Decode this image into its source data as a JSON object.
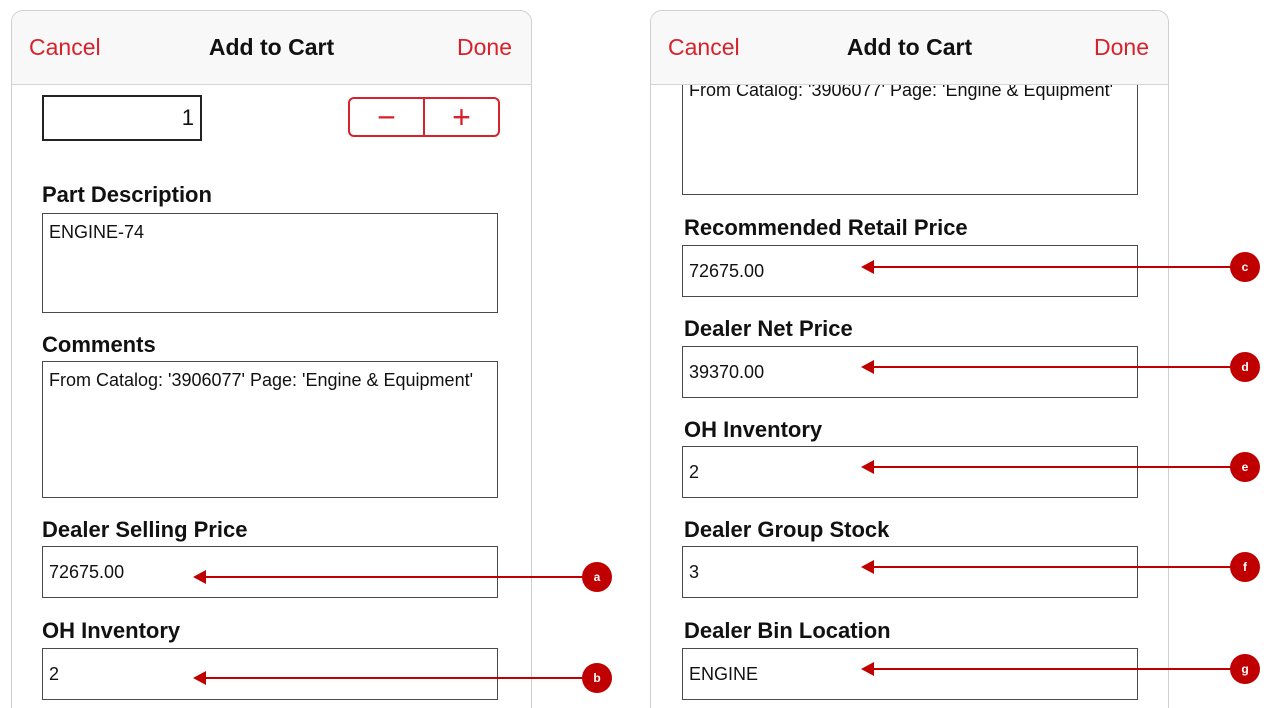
{
  "left_panel": {
    "navbar": {
      "cancel": "Cancel",
      "title": "Add to Cart",
      "done": "Done"
    },
    "quantity": {
      "value": "1"
    },
    "stepper": {
      "minus": "−",
      "plus": "+"
    },
    "part_description": {
      "label": "Part Description",
      "value": "ENGINE-74"
    },
    "comments": {
      "label": "Comments",
      "value": "From Catalog: '3906077' Page: 'Engine & Equipment'"
    },
    "dealer_selling_price": {
      "label": "Dealer Selling Price",
      "value": "72675.00"
    },
    "oh_inventory": {
      "label": "OH Inventory",
      "value": "2"
    }
  },
  "right_panel": {
    "navbar": {
      "cancel": "Cancel",
      "title": "Add to Cart",
      "done": "Done"
    },
    "comments_partial": {
      "value": "From Catalog: '3906077' Page: 'Engine & Equipment'"
    },
    "recommended_retail_price": {
      "label": "Recommended Retail Price",
      "value": "72675.00"
    },
    "dealer_net_price": {
      "label": "Dealer Net Price",
      "value": "39370.00"
    },
    "oh_inventory": {
      "label": "OH Inventory",
      "value": "2"
    },
    "dealer_group_stock": {
      "label": "Dealer Group Stock",
      "value": "3"
    },
    "dealer_bin_location": {
      "label": "Dealer Bin Location",
      "value": "ENGINE"
    }
  },
  "callouts": {
    "a": "a",
    "b": "b",
    "c": "c",
    "d": "d",
    "e": "e",
    "f": "f",
    "g": "g"
  },
  "colors": {
    "accent": "#d7222b",
    "callout": "#c00000",
    "navbar_bg": "#f8f8f8"
  }
}
